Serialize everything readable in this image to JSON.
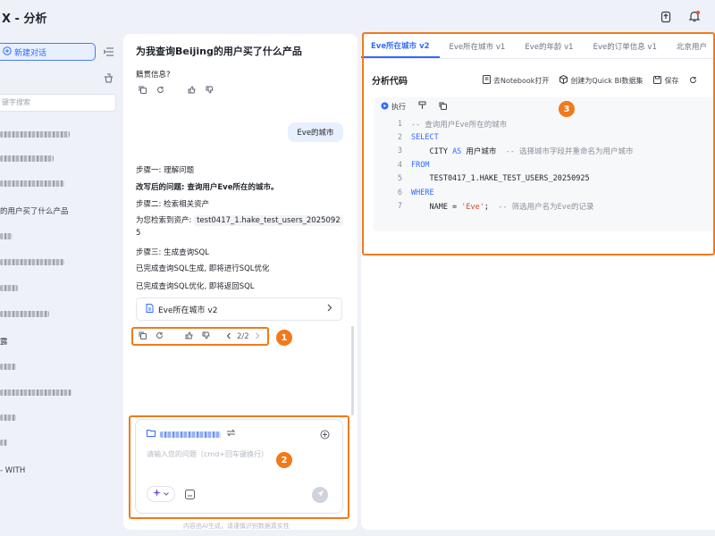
{
  "app_title": "X - 分析",
  "sidebar": {
    "new_chat_label": "新建对话",
    "search_placeholder": "键字搜索",
    "history_visible_text": [
      "的用户买了什么产品",
      "露",
      "- WITH"
    ]
  },
  "chat": {
    "title": "为我查询Beijing的用户买了什么产品",
    "prev_answer_tail": "籍贯信息?",
    "user_message": "Eve的城市",
    "step1_title": "步骤一: 理解问题",
    "step1_text": "改写后的问题: 查询用户Eve所在的城市。",
    "step2_title": "步骤二: 检索相关资产",
    "step2_prefix": "为您检索到资产:",
    "step2_asset": "test0417_1.hake_test_users_2025092",
    "step2_asset_cont": "5",
    "step3_title": "步骤三: 生成查询SQL",
    "step3_text1": "已完成查询SQL生成, 即将进行SQL优化",
    "step3_text2": "已完成查询SQL优化, 即将返回SQL",
    "ref_card_label": "Eve所在城市 v2",
    "pager": "2/2",
    "input_placeholder": "请输入您的问题（cmd+回车键换行）",
    "footer_note": "内容由AI生成，请谨慎识别数据真实性"
  },
  "annotations": [
    "1",
    "2",
    "3"
  ],
  "right_panel": {
    "tabs": [
      {
        "label": "Eve所在城市 v2",
        "active": true
      },
      {
        "label": "Eve所在城市 v1",
        "active": false
      },
      {
        "label": "Eve的年龄 v1",
        "active": false
      },
      {
        "label": "Eve的订单信息 v1",
        "active": false
      },
      {
        "label": "北京用户",
        "active": false
      }
    ],
    "section_title": "分析代码",
    "toolbar": {
      "notebook": "去Notebook打开",
      "create_dataset": "创建为Quick BI数据集",
      "save": "保存"
    },
    "run_label": "执行",
    "code_lines": [
      {
        "num": "1",
        "text": "-- 查询用户Eve所在的城市"
      },
      {
        "num": "2",
        "text": "SELECT"
      },
      {
        "num": "3",
        "text": "    CITY AS 用户城市  -- 选择城市字段并重命名为用户城市"
      },
      {
        "num": "4",
        "text": "FROM"
      },
      {
        "num": "5",
        "text": "    TEST0417_1.HAKE_TEST_USERS_20250925"
      },
      {
        "num": "6",
        "text": "WHERE"
      },
      {
        "num": "7",
        "text": "    NAME = 'Eve';  -- 筛选用户名为Eve的记录"
      }
    ]
  },
  "colors": {
    "accent": "#2f6bff",
    "annotation": "#f07a1c",
    "background": "#eef1f7"
  }
}
